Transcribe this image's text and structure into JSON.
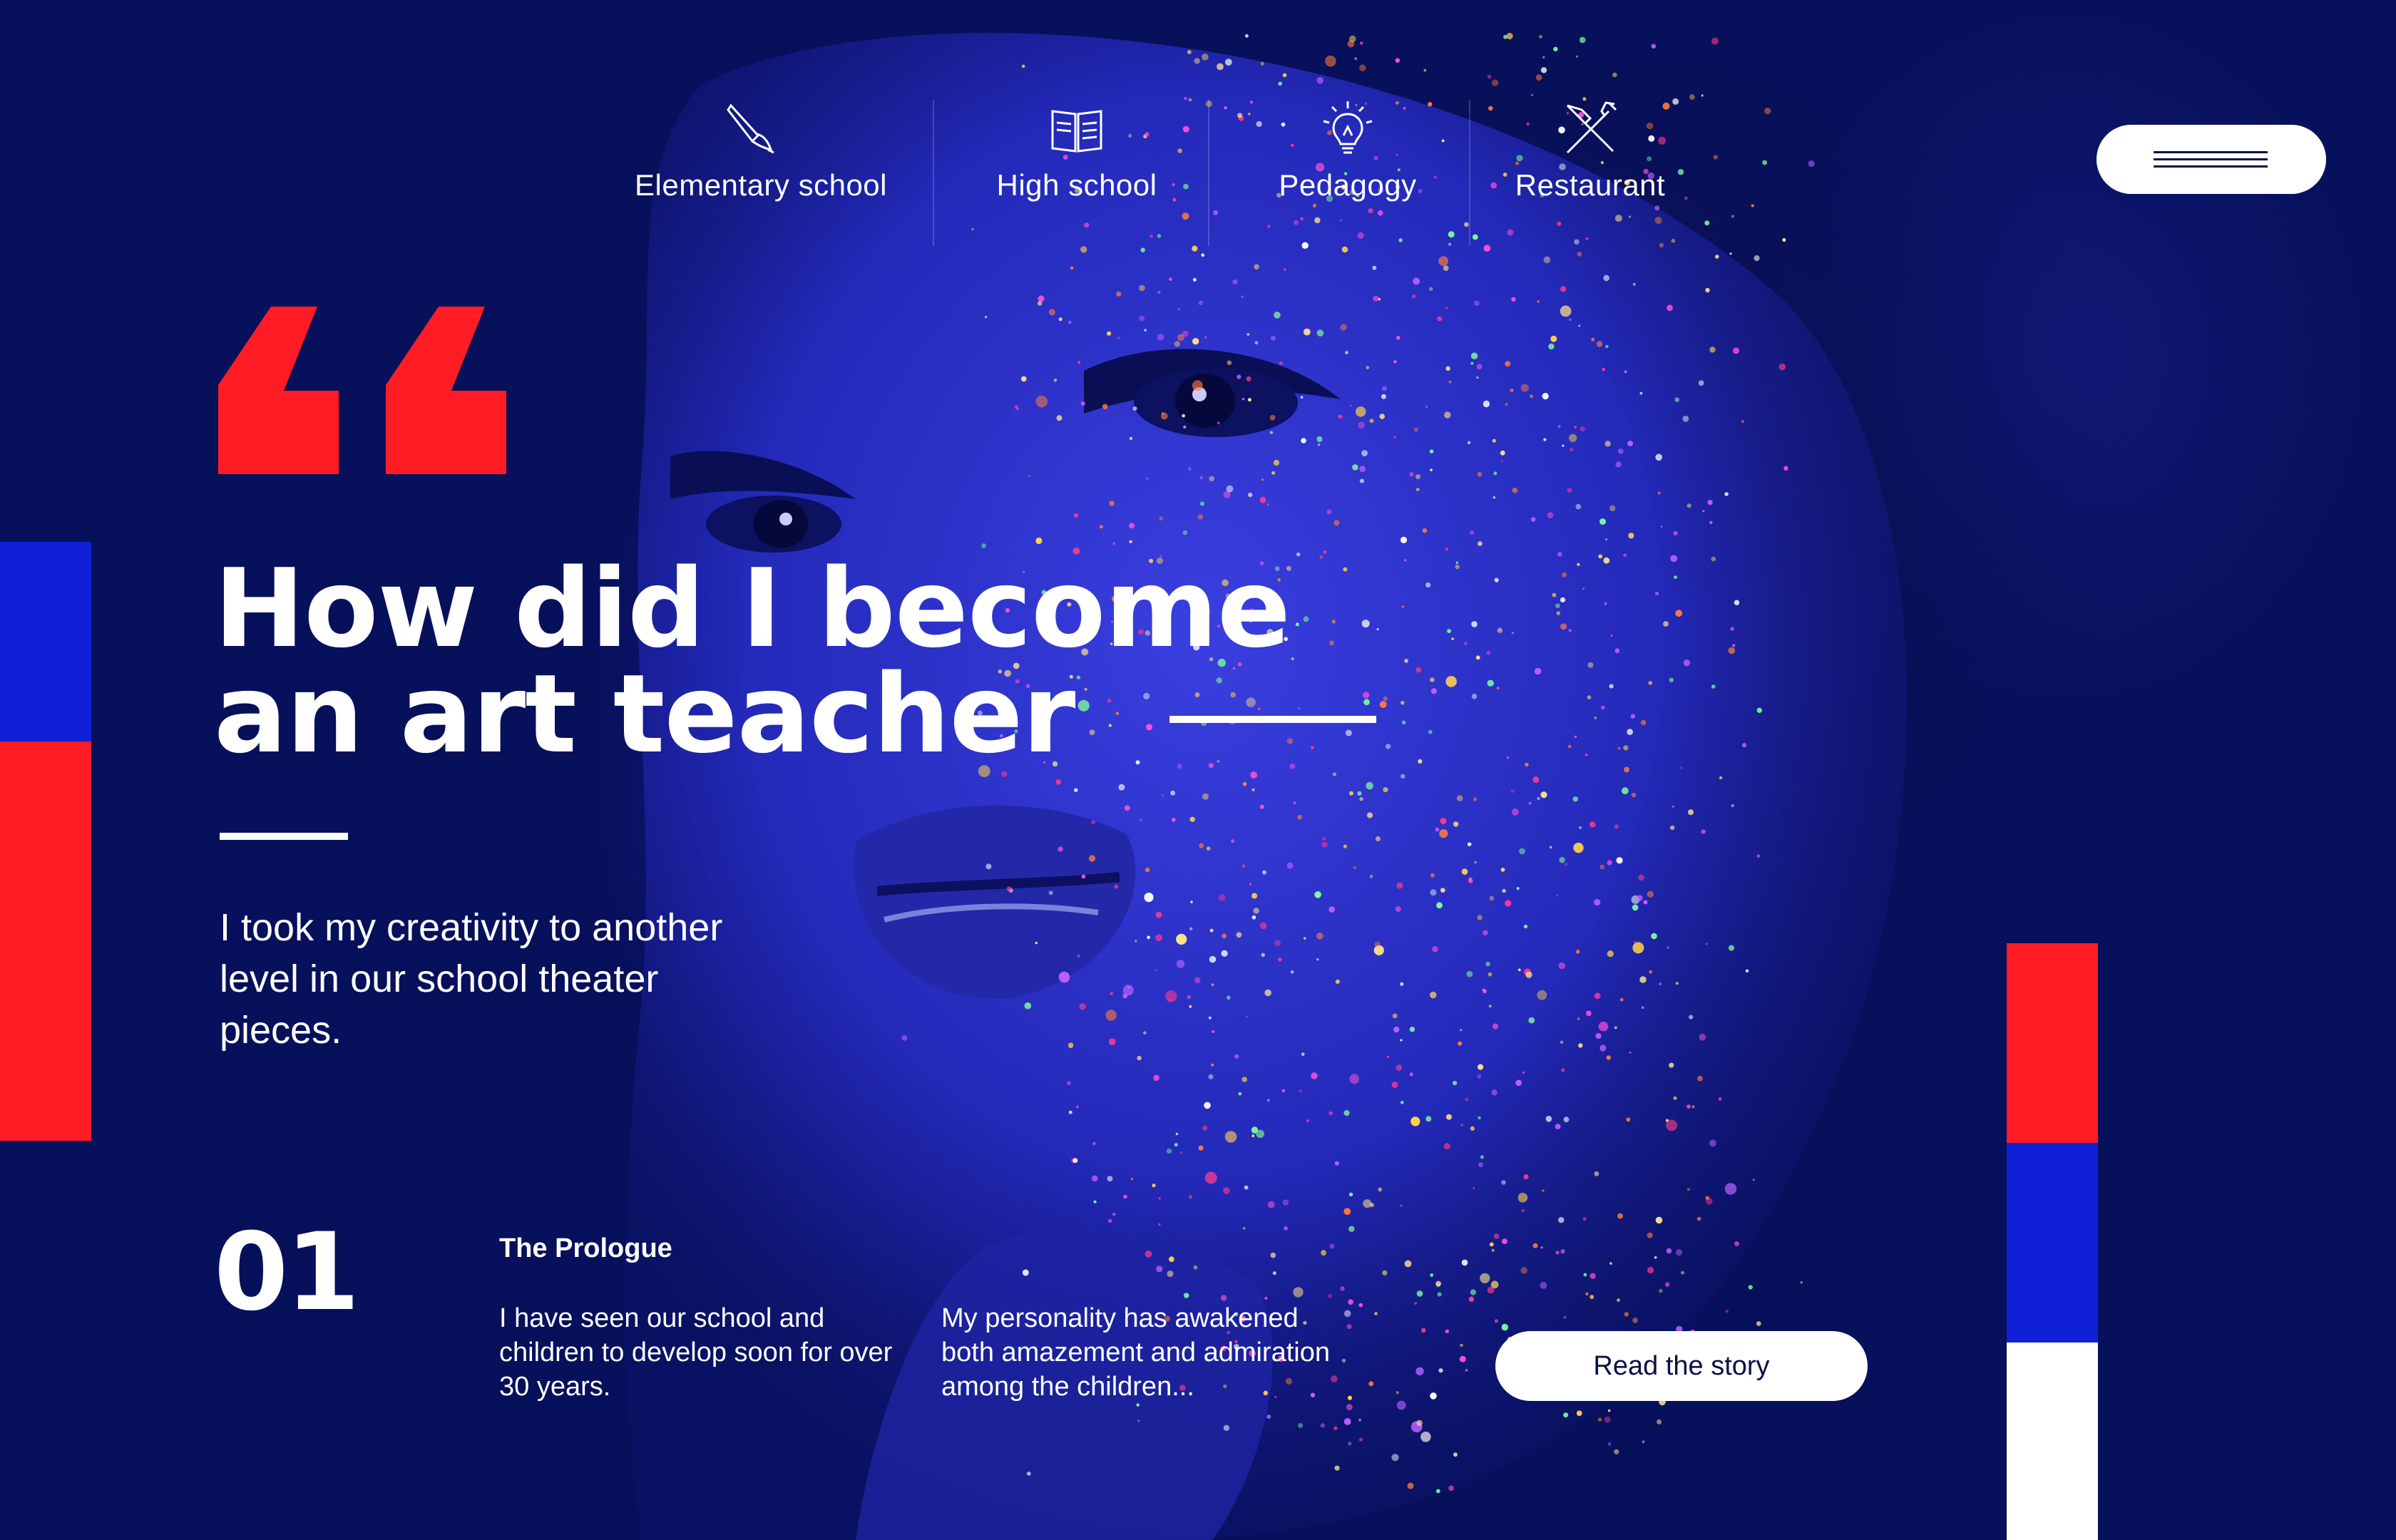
{
  "nav": {
    "items": [
      {
        "label": "Elementary school",
        "icon": "paintbrush-icon"
      },
      {
        "label": "High school",
        "icon": "book-icon"
      },
      {
        "label": "Pedagogy",
        "icon": "lightbulb-icon"
      },
      {
        "label": "Restaurant",
        "icon": "fork-knife-icon"
      }
    ]
  },
  "menu": {
    "icon": "hamburger-icon"
  },
  "hero": {
    "headline_line1": "How did I become",
    "headline_line2": "an art teacher",
    "lead": "I took my creativity to another level in our school theater pieces."
  },
  "chapter": {
    "number": "01",
    "title": "The Prologue",
    "text_1": "I have seen our school and children to develop soon for over 30 years.",
    "text_2": "My personality has awakened both amazement and admiration among the children...",
    "button_label": "Read the story"
  },
  "colors": {
    "background": "#07105a",
    "accent_red": "#ff1c24",
    "accent_blue": "#1020d6",
    "white": "#ffffff"
  }
}
